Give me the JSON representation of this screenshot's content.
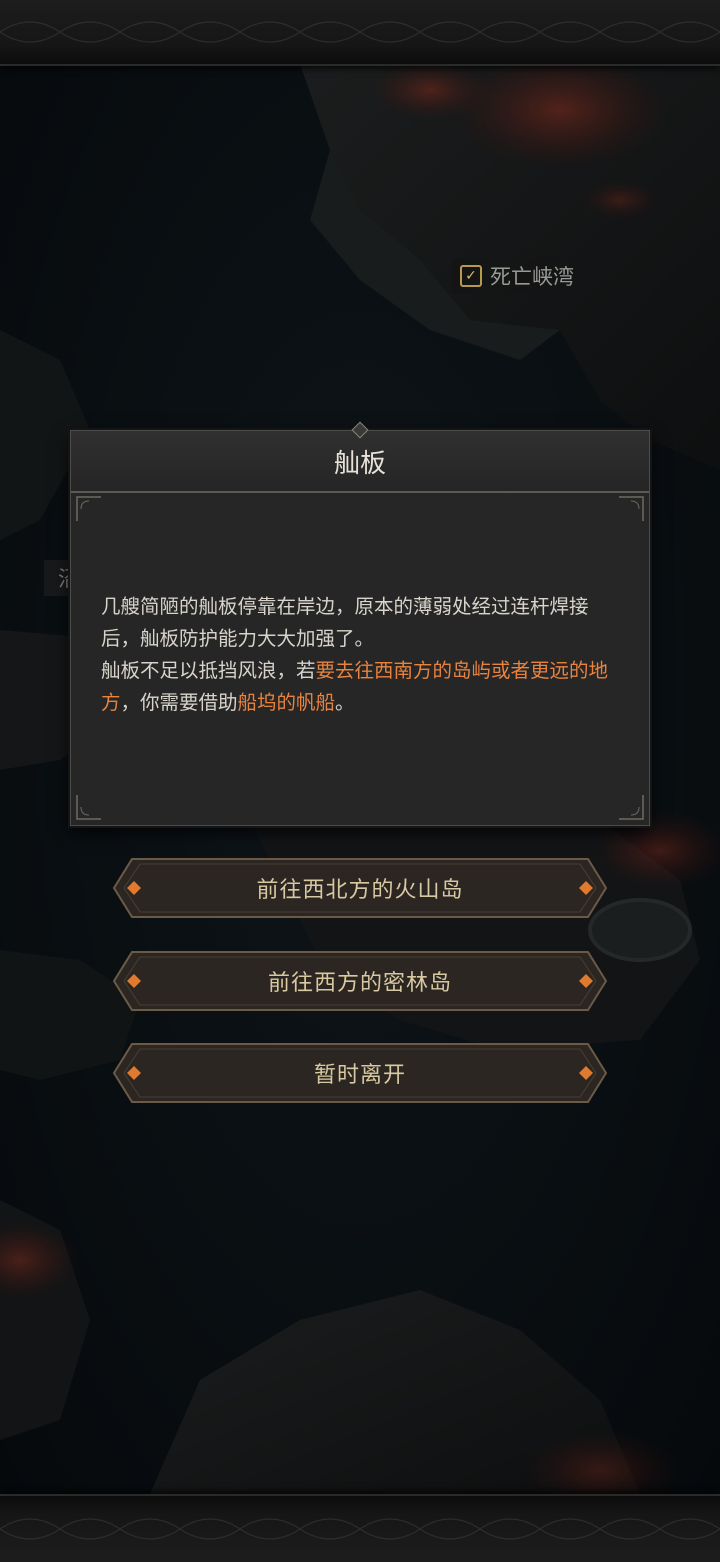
{
  "map": {
    "location_label": "死亡峡湾",
    "partial_label": "沼地"
  },
  "dialog": {
    "title": "舢板",
    "paragraph1": "几艘简陋的舢板停靠在岸边，原本的薄弱处经过连杆焊接后，舢板防护能力大大加强了。",
    "p2_part1": "舢板不足以抵挡风浪，若",
    "p2_highlight1": "要去往西南方的岛屿或者更远的地方",
    "p2_part2": "，你需要借助",
    "p2_highlight2": "船坞的帆船",
    "p2_part3": "。"
  },
  "choices": [
    {
      "label": "前往西北方的火山岛"
    },
    {
      "label": "前往西方的密林岛"
    },
    {
      "label": "暂时离开"
    }
  ],
  "colors": {
    "highlight": "#e8833f",
    "button_text": "#d9c9a2",
    "ember": "#c0392b"
  }
}
